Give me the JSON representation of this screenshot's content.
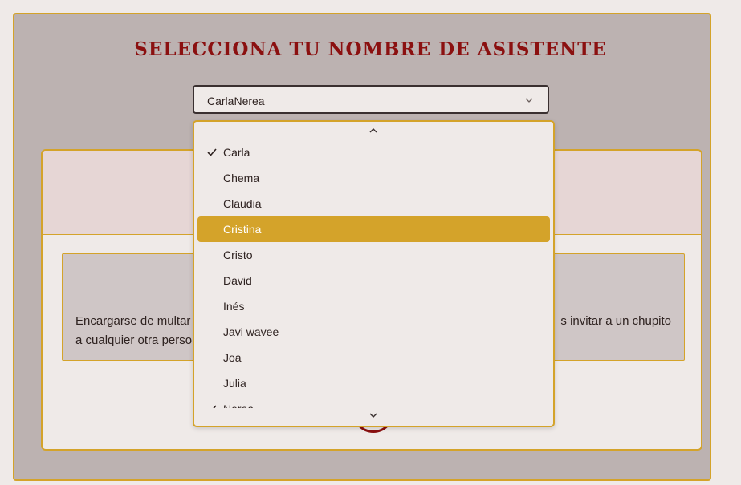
{
  "page": {
    "title": "SELECCIONA TU NOMBRE DE ASISTENTE"
  },
  "select": {
    "value": "CarlaNerea",
    "icon": "chevron-down-icon"
  },
  "dropdown": {
    "options": [
      {
        "label": "Carla",
        "checked": true,
        "highlighted": false
      },
      {
        "label": "Chema",
        "checked": false,
        "highlighted": false
      },
      {
        "label": "Claudia",
        "checked": false,
        "highlighted": false
      },
      {
        "label": "Cristina",
        "checked": false,
        "highlighted": true
      },
      {
        "label": "Cristo",
        "checked": false,
        "highlighted": false
      },
      {
        "label": "David",
        "checked": false,
        "highlighted": false
      },
      {
        "label": "Inés",
        "checked": false,
        "highlighted": false
      },
      {
        "label": "Javi wavee",
        "checked": false,
        "highlighted": false
      },
      {
        "label": "Joa",
        "checked": false,
        "highlighted": false
      },
      {
        "label": "Julia",
        "checked": false,
        "highlighted": false
      },
      {
        "label": "Nerea",
        "checked": true,
        "highlighted": false
      }
    ]
  },
  "card": {
    "text_left": "Encargarse de multar a",
    "text_left_line2": "a cualquier otra persona",
    "text_right": "s invitar a un chupito"
  },
  "colors": {
    "accent": "#d4a32a",
    "title": "#8b1010",
    "overlay": "#bcb2b1"
  }
}
